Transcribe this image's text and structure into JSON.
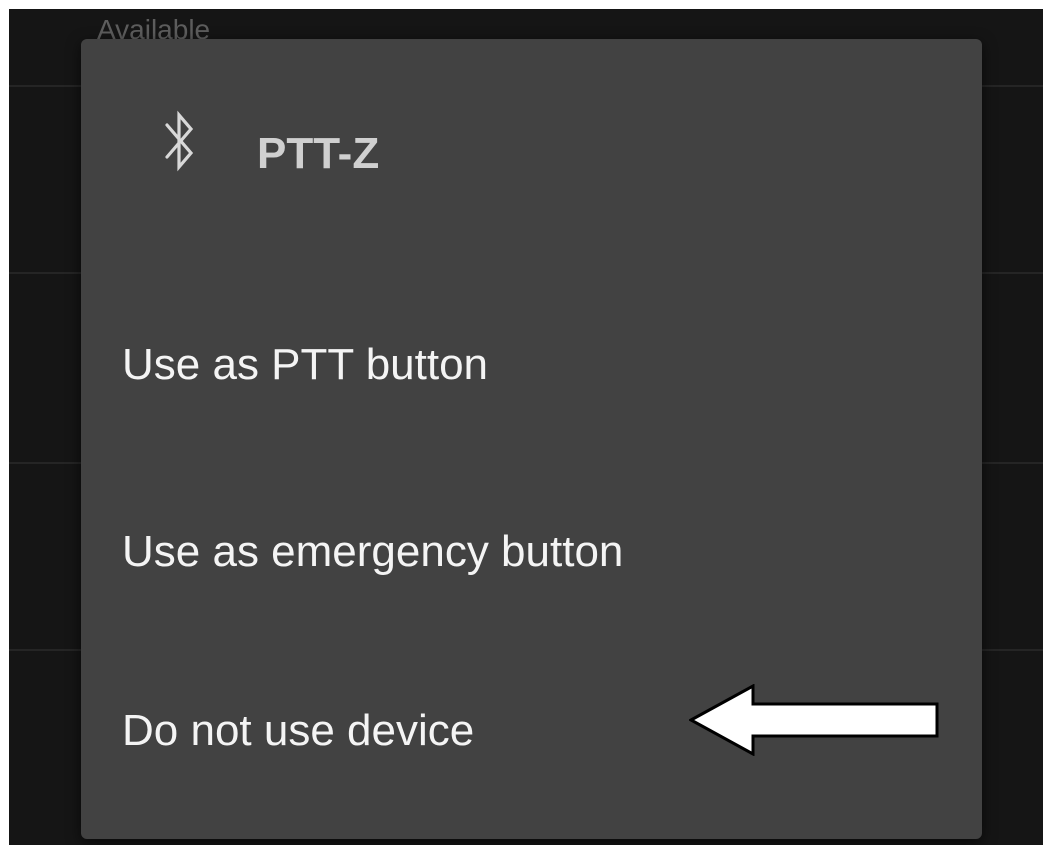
{
  "background": {
    "header": "Available"
  },
  "dialog": {
    "icon": "bluetooth-icon",
    "title": "PTT-Z",
    "options": [
      {
        "label": "Use as PTT button"
      },
      {
        "label": "Use as emergency button"
      },
      {
        "label": "Do not use device"
      }
    ],
    "annotation": "arrow-left-icon"
  },
  "colors": {
    "screen_bg": "#151515",
    "dialog_bg": "#424242",
    "text": "#f4f4f4",
    "title_text": "#d0d0d0",
    "annotation_arrow": "#ffffff"
  }
}
